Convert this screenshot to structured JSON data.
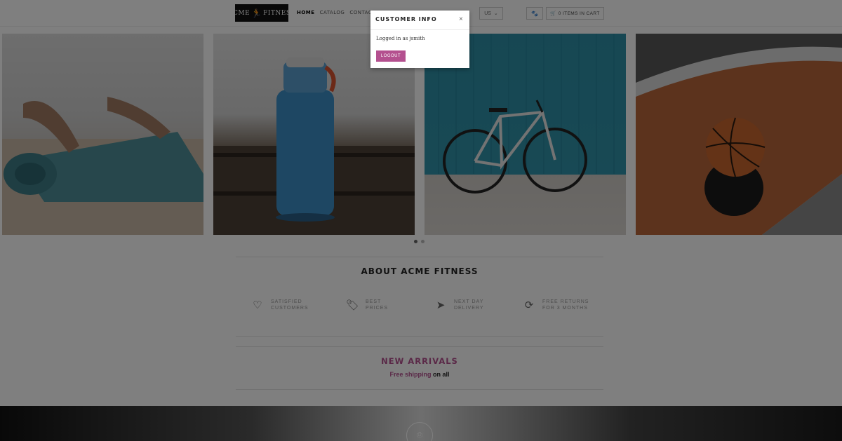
{
  "header": {
    "logo_left": "ACME",
    "logo_right": "FITNESS",
    "nav": [
      "HOME",
      "CATALOG",
      "CONTACT"
    ],
    "currency": "US",
    "cart_label": "0 ITEMS IN CART"
  },
  "carousel": {
    "slides": [
      "yoga-mat",
      "water-bottle",
      "bicycle",
      "basketball"
    ],
    "active_dot": 0
  },
  "about": {
    "title": "ABOUT ACME FITNESS",
    "features": [
      {
        "icon": "heart-icon",
        "line1": "SATISFIED",
        "line2": "CUSTOMERS"
      },
      {
        "icon": "tags-icon",
        "line1": "BEST",
        "line2": "PRICES"
      },
      {
        "icon": "paper-plane-icon",
        "line1": "NEXT DAY",
        "line2": "DELIVERY"
      },
      {
        "icon": "refresh-icon",
        "line1": "FREE RETURNS",
        "line2": "FOR 3 MONTHS"
      }
    ]
  },
  "arrivals": {
    "title": "NEW ARRIVALS",
    "shipping_highlight": "Free shipping",
    "shipping_rest": " on all"
  },
  "modal": {
    "title": "CUSTOMER INFO",
    "close": "×",
    "message": "Logged in as jsmith",
    "logout": "LOGOUT"
  },
  "colors": {
    "accent": "#b4508f",
    "overlay": "rgba(0,0,0,0.5)"
  }
}
